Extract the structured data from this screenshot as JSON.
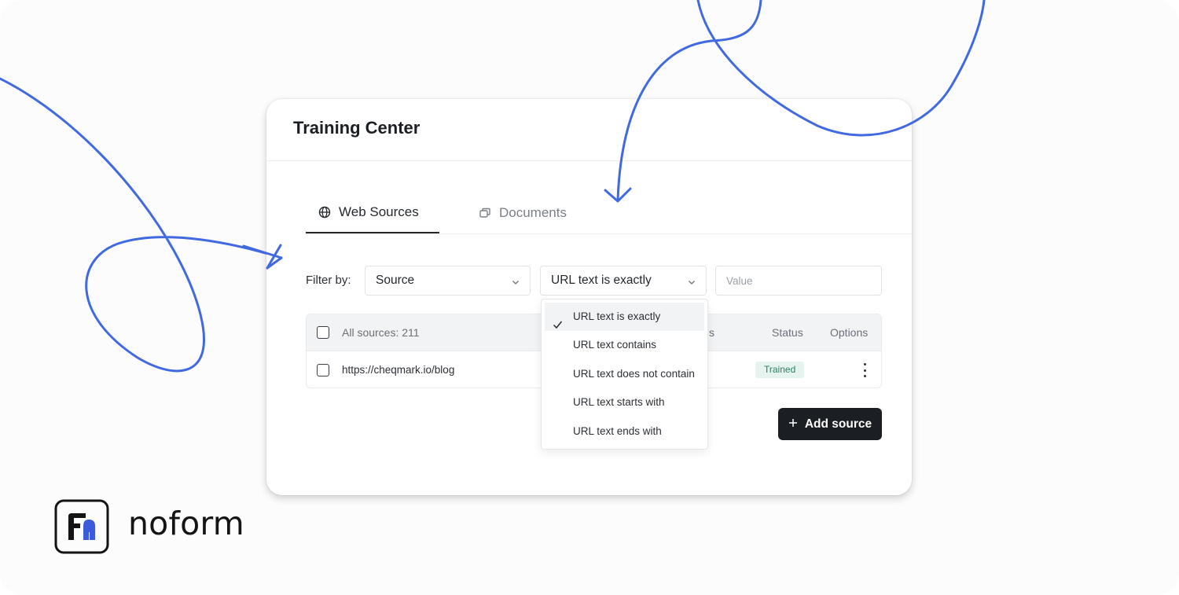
{
  "card": {
    "title": "Training Center"
  },
  "tabs": [
    {
      "label": "Web Sources",
      "icon": "globe-icon",
      "active": true
    },
    {
      "label": "Documents",
      "icon": "documents-icon",
      "active": false
    }
  ],
  "filter": {
    "label": "Filter by:",
    "source_value": "Source",
    "match_value": "URL text is exactly",
    "value_placeholder": "Value"
  },
  "dropdown": {
    "options": [
      "URL text is exactly",
      "URL text contains",
      "URL text does not contain",
      "URL text starts with",
      "URL text ends with"
    ],
    "selected_index": 0
  },
  "table": {
    "header": {
      "all_sources": "All sources: 211",
      "partial": "s",
      "status": "Status",
      "options": "Options"
    },
    "rows": [
      {
        "url": "https://cheqmark.io/blog",
        "status": "Trained"
      }
    ]
  },
  "add_button": {
    "label": "Add source"
  },
  "brand": {
    "name": "noform",
    "accent": "#3b5bdb",
    "decor_line": "#4169e1"
  }
}
